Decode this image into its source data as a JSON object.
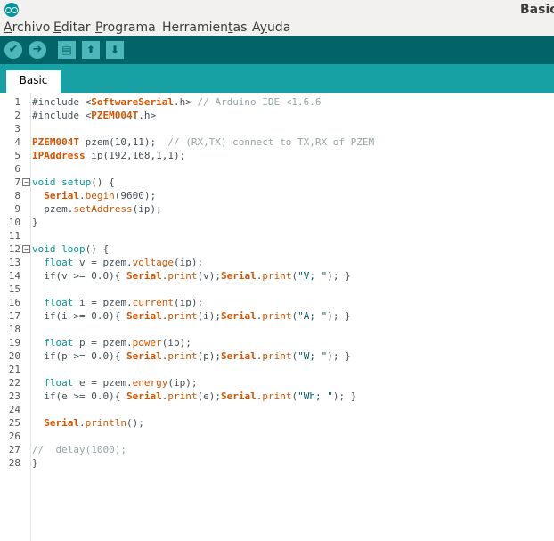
{
  "window": {
    "title": "Basic"
  },
  "menu": [
    "Archivo",
    "Editar",
    "Programa",
    "Herramientas",
    "Ayuda"
  ],
  "menu_mnemonics": [
    "A",
    "E",
    "P",
    "t",
    "y"
  ],
  "toolbar": {
    "verify_icon": "checkmark-icon",
    "upload_icon": "arrow-right-icon",
    "new_icon": "document-icon",
    "open_icon": "arrow-up-icon",
    "save_icon": "arrow-down-icon"
  },
  "tabs": [
    {
      "label": "Basic"
    }
  ],
  "colors": {
    "toolbar": "#006468",
    "tabbar": "#17a1a5",
    "type": "#00979c",
    "function": "#d35400",
    "comment": "#95a5a6",
    "string": "#005c5f"
  },
  "code": [
    {
      "n": "1",
      "t": [
        [
          "p",
          "#include <"
        ],
        [
          "c",
          "SoftwareSerial"
        ],
        [
          "p",
          ".h> "
        ],
        [
          "m",
          "// Arduino IDE <1.6.6"
        ]
      ]
    },
    {
      "n": "2",
      "t": [
        [
          "p",
          "#include <"
        ],
        [
          "c",
          "PZEM004T"
        ],
        [
          "p",
          ".h>"
        ]
      ]
    },
    {
      "n": "3",
      "t": []
    },
    {
      "n": "4",
      "t": [
        [
          "c",
          "PZEM004T"
        ],
        [
          "p",
          " pzem(10,11);  "
        ],
        [
          "m",
          "// (RX,TX) connect to TX,RX of PZEM"
        ]
      ]
    },
    {
      "n": "5",
      "t": [
        [
          "c",
          "IPAddress"
        ],
        [
          "p",
          " ip(192,168,1,1);"
        ]
      ]
    },
    {
      "n": "6",
      "t": []
    },
    {
      "n": "7",
      "fold": true,
      "t": [
        [
          "k",
          "void"
        ],
        [
          "p",
          " "
        ],
        [
          "k",
          "setup"
        ],
        [
          "p",
          "() {"
        ]
      ]
    },
    {
      "n": "8",
      "t": [
        [
          "p",
          "  "
        ],
        [
          "c",
          "Serial"
        ],
        [
          "p",
          "."
        ],
        [
          "f",
          "begin"
        ],
        [
          "p",
          "(9600);"
        ]
      ]
    },
    {
      "n": "9",
      "t": [
        [
          "p",
          "  pzem."
        ],
        [
          "f",
          "setAddress"
        ],
        [
          "p",
          "(ip);"
        ]
      ]
    },
    {
      "n": "10",
      "t": [
        [
          "p",
          "}"
        ]
      ]
    },
    {
      "n": "11",
      "t": []
    },
    {
      "n": "12",
      "fold": true,
      "t": [
        [
          "k",
          "void"
        ],
        [
          "p",
          " "
        ],
        [
          "k",
          "loop"
        ],
        [
          "p",
          "() {"
        ]
      ]
    },
    {
      "n": "13",
      "t": [
        [
          "p",
          "  "
        ],
        [
          "k",
          "float"
        ],
        [
          "p",
          " v = pzem."
        ],
        [
          "f",
          "voltage"
        ],
        [
          "p",
          "(ip);"
        ]
      ]
    },
    {
      "n": "14",
      "t": [
        [
          "p",
          "  "
        ],
        [
          "p",
          "if"
        ],
        [
          "p",
          "(v >= 0.0){ "
        ],
        [
          "c",
          "Serial"
        ],
        [
          "p",
          "."
        ],
        [
          "f",
          "print"
        ],
        [
          "p",
          "(v);"
        ],
        [
          "c",
          "Serial"
        ],
        [
          "p",
          "."
        ],
        [
          "f",
          "print"
        ],
        [
          "p",
          "("
        ],
        [
          "s",
          "\"V; \""
        ],
        [
          "p",
          "); }"
        ]
      ]
    },
    {
      "n": "15",
      "t": []
    },
    {
      "n": "16",
      "t": [
        [
          "p",
          "  "
        ],
        [
          "k",
          "float"
        ],
        [
          "p",
          " i = pzem."
        ],
        [
          "f",
          "current"
        ],
        [
          "p",
          "(ip);"
        ]
      ]
    },
    {
      "n": "17",
      "t": [
        [
          "p",
          "  "
        ],
        [
          "p",
          "if"
        ],
        [
          "p",
          "(i >= 0.0){ "
        ],
        [
          "c",
          "Serial"
        ],
        [
          "p",
          "."
        ],
        [
          "f",
          "print"
        ],
        [
          "p",
          "(i);"
        ],
        [
          "c",
          "Serial"
        ],
        [
          "p",
          "."
        ],
        [
          "f",
          "print"
        ],
        [
          "p",
          "("
        ],
        [
          "s",
          "\"A; \""
        ],
        [
          "p",
          "); }"
        ]
      ]
    },
    {
      "n": "18",
      "t": []
    },
    {
      "n": "19",
      "t": [
        [
          "p",
          "  "
        ],
        [
          "k",
          "float"
        ],
        [
          "p",
          " p = pzem."
        ],
        [
          "f",
          "power"
        ],
        [
          "p",
          "(ip);"
        ]
      ]
    },
    {
      "n": "20",
      "t": [
        [
          "p",
          "  "
        ],
        [
          "p",
          "if"
        ],
        [
          "p",
          "(p >= 0.0){ "
        ],
        [
          "c",
          "Serial"
        ],
        [
          "p",
          "."
        ],
        [
          "f",
          "print"
        ],
        [
          "p",
          "(p);"
        ],
        [
          "c",
          "Serial"
        ],
        [
          "p",
          "."
        ],
        [
          "f",
          "print"
        ],
        [
          "p",
          "("
        ],
        [
          "s",
          "\"W; \""
        ],
        [
          "p",
          "); }"
        ]
      ]
    },
    {
      "n": "21",
      "t": []
    },
    {
      "n": "22",
      "t": [
        [
          "p",
          "  "
        ],
        [
          "k",
          "float"
        ],
        [
          "p",
          " e = pzem."
        ],
        [
          "f",
          "energy"
        ],
        [
          "p",
          "(ip);"
        ]
      ]
    },
    {
      "n": "23",
      "t": [
        [
          "p",
          "  "
        ],
        [
          "p",
          "if"
        ],
        [
          "p",
          "(e >= 0.0){ "
        ],
        [
          "c",
          "Serial"
        ],
        [
          "p",
          "."
        ],
        [
          "f",
          "print"
        ],
        [
          "p",
          "(e);"
        ],
        [
          "c",
          "Serial"
        ],
        [
          "p",
          "."
        ],
        [
          "f",
          "print"
        ],
        [
          "p",
          "("
        ],
        [
          "s",
          "\"Wh; \""
        ],
        [
          "p",
          "); }"
        ]
      ]
    },
    {
      "n": "24",
      "t": []
    },
    {
      "n": "25",
      "t": [
        [
          "p",
          "  "
        ],
        [
          "c",
          "Serial"
        ],
        [
          "p",
          "."
        ],
        [
          "f",
          "println"
        ],
        [
          "p",
          "();"
        ]
      ]
    },
    {
      "n": "26",
      "t": []
    },
    {
      "n": "27",
      "t": [
        [
          "m",
          "//  delay(1000);"
        ]
      ]
    },
    {
      "n": "28",
      "t": [
        [
          "p",
          "}"
        ]
      ]
    }
  ]
}
